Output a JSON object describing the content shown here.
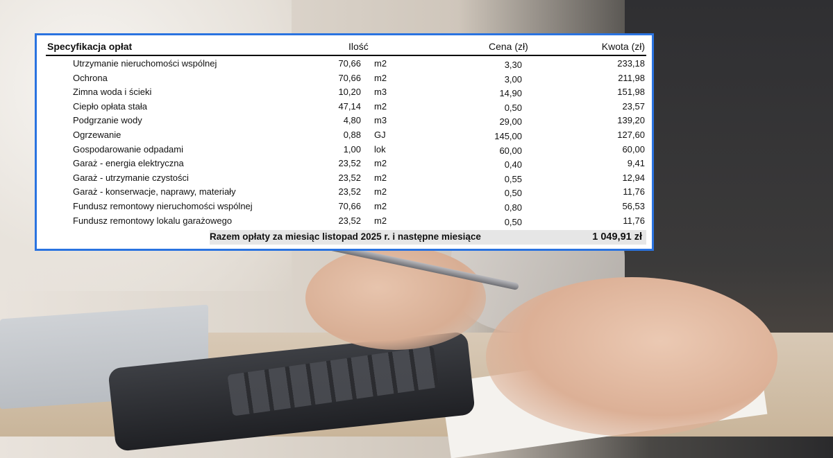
{
  "spec": {
    "title": "Specyfikacja opłat",
    "col_qty": "Ilość",
    "col_price": "Cena (zł)",
    "col_amount": "Kwota (zł)",
    "rows": [
      {
        "name": "Utrzymanie nieruchomości wspólnej",
        "qty": "70,66",
        "unit": "m2",
        "price": "3,30",
        "amount": "233,18"
      },
      {
        "name": "Ochrona",
        "qty": "70,66",
        "unit": "m2",
        "price": "3,00",
        "amount": "211,98"
      },
      {
        "name": "Zimna woda i ścieki",
        "qty": "10,20",
        "unit": "m3",
        "price": "14,90",
        "amount": "151,98"
      },
      {
        "name": "Ciepło opłata stała",
        "qty": "47,14",
        "unit": "m2",
        "price": "0,50",
        "amount": "23,57"
      },
      {
        "name": "Podgrzanie wody",
        "qty": "4,80",
        "unit": "m3",
        "price": "29,00",
        "amount": "139,20"
      },
      {
        "name": "Ogrzewanie",
        "qty": "0,88",
        "unit": "GJ",
        "price": "145,00",
        "amount": "127,60"
      },
      {
        "name": "Gospodarowanie odpadami",
        "qty": "1,00",
        "unit": "lok",
        "price": "60,00",
        "amount": "60,00"
      },
      {
        "name": "Garaż - energia elektryczna",
        "qty": "23,52",
        "unit": "m2",
        "price": "0,40",
        "amount": "9,41"
      },
      {
        "name": "Garaż - utrzymanie czystości",
        "qty": "23,52",
        "unit": "m2",
        "price": "0,55",
        "amount": "12,94"
      },
      {
        "name": "Garaż - konserwacje, naprawy, materiały",
        "qty": "23,52",
        "unit": "m2",
        "price": "0,50",
        "amount": "11,76"
      },
      {
        "name": "Fundusz remontowy nieruchomości wspólnej",
        "qty": "70,66",
        "unit": "m2",
        "price": "0,80",
        "amount": "56,53"
      },
      {
        "name": "Fundusz remontowy lokalu garażowego",
        "qty": "23,52",
        "unit": "m2",
        "price": "0,50",
        "amount": "11,76"
      }
    ],
    "total_label": "Razem opłaty za miesiąc listopad 2025 r. i następne miesiące",
    "total_value": "1 049,91 zł"
  },
  "colors": {
    "frame_border": "#2a73e0",
    "total_bg": "#e6e6e6"
  }
}
